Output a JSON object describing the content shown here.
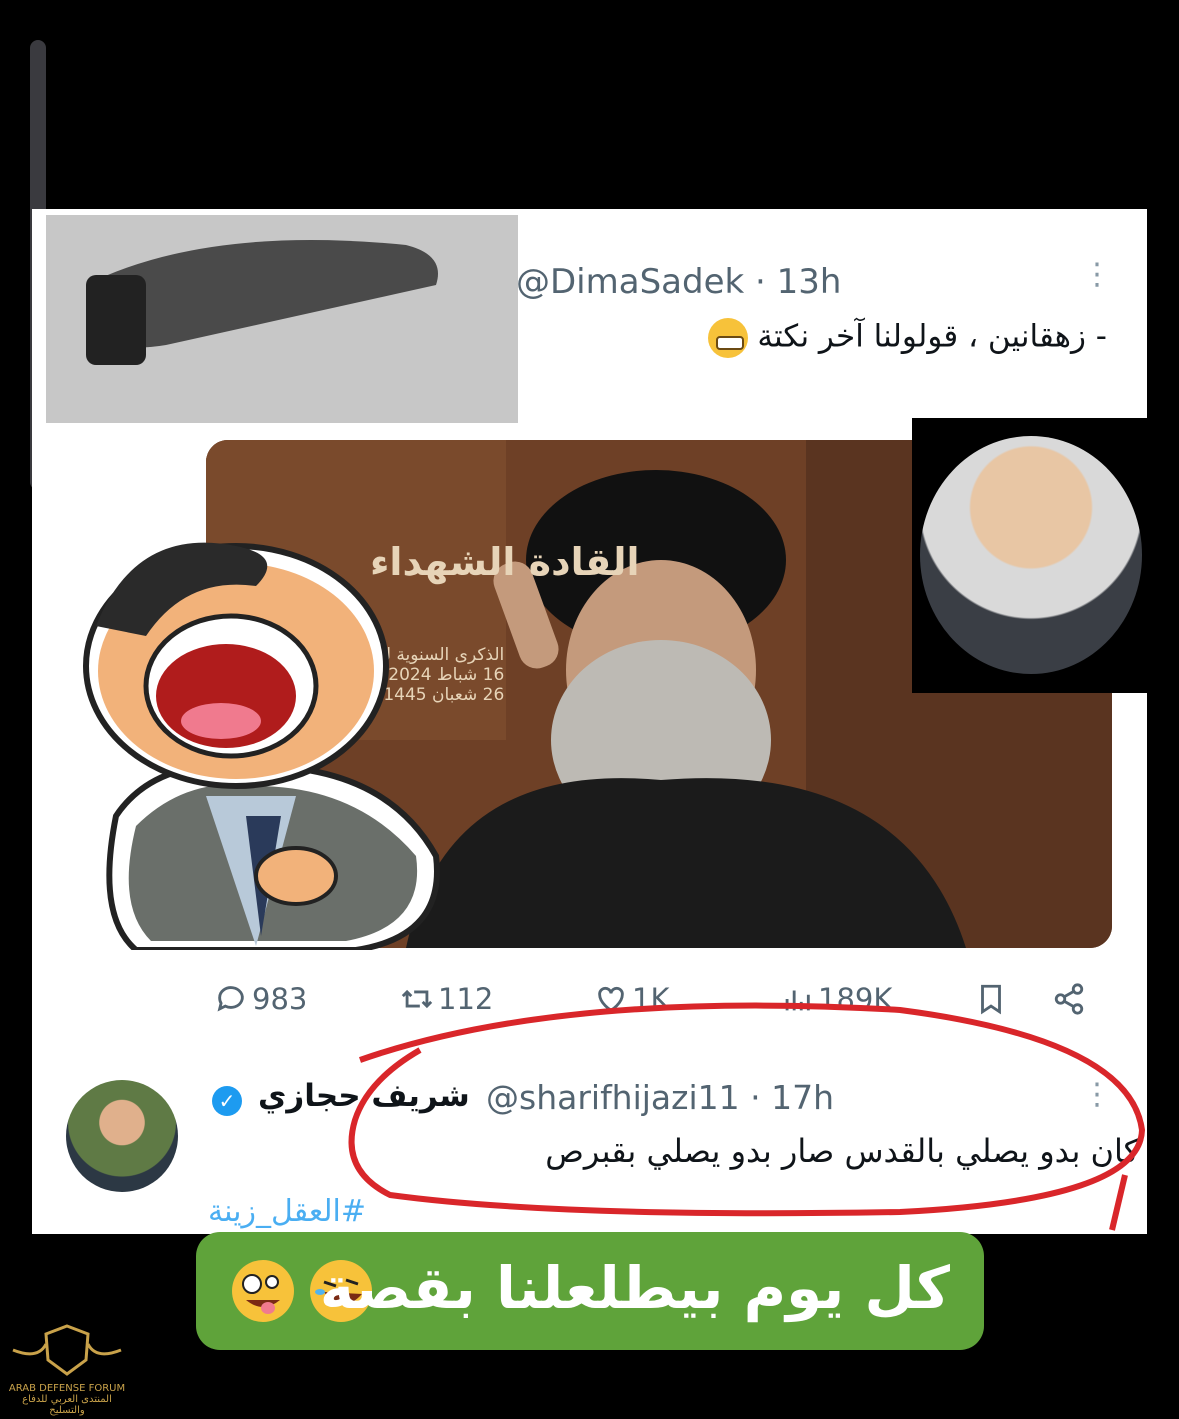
{
  "tweet1": {
    "handle": "@DimaSadek · 13h",
    "text": "- زهقانين ، قولولنا آخر نكتة",
    "more": "⋮"
  },
  "poster": {
    "title": "القادة الشهداء",
    "subtitle": "الذكرى السنوية للقادة الشهداء",
    "date1": "16 شباط 2024م",
    "date2": "26 شعبان 1445هـ"
  },
  "actions": {
    "replies": "983",
    "retweets": "112",
    "likes": "1K",
    "views": "189K"
  },
  "reply": {
    "name": "شريف حجازي",
    "handle": "@sharifhijazi11 · 17h",
    "text": "كان بدو يصلي بالقدس صار بدو يصلي بقبرص",
    "hashtag": "#العقل_زينة",
    "more": "⋮"
  },
  "banner": {
    "text": "كل يوم بيطلعلنا بقصة"
  },
  "logo": {
    "text": "المنتدى العربي للدفاع والتسليح",
    "text_en": "ARAB DEFENSE FORUM"
  },
  "colors": {
    "accent": "#1d9bf0",
    "red_annotation": "#d9262a",
    "banner_green": "#5fa33a"
  }
}
